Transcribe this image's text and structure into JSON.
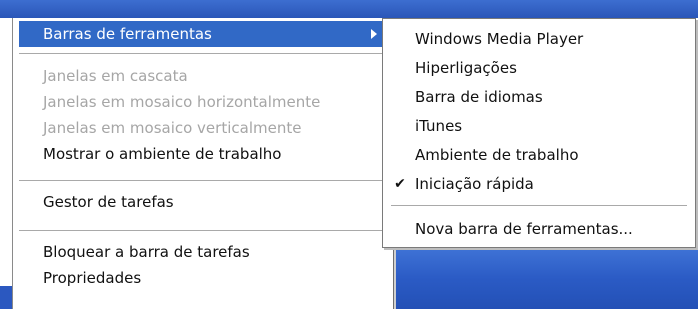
{
  "context_menu": {
    "items": [
      {
        "label": "Barras de ferramentas",
        "state": "selected",
        "has_submenu": true
      },
      {
        "label": "Janelas em cascata",
        "state": "disabled"
      },
      {
        "label": "Janelas em mosaico horizontalmente",
        "state": "disabled"
      },
      {
        "label": "Janelas em mosaico verticalmente",
        "state": "disabled"
      },
      {
        "label": "Mostrar o ambiente de trabalho",
        "state": "enabled"
      },
      {
        "label": "Gestor de tarefas",
        "state": "enabled"
      },
      {
        "label": "Bloquear a barra de tarefas",
        "state": "enabled"
      },
      {
        "label": "Propriedades",
        "state": "enabled"
      }
    ]
  },
  "toolbars_submenu": {
    "items": [
      {
        "label": "Windows Media Player",
        "checked": false
      },
      {
        "label": "Hiperligações",
        "checked": false
      },
      {
        "label": "Barra de idiomas",
        "checked": false
      },
      {
        "label": "iTunes",
        "checked": false
      },
      {
        "label": "Ambiente de trabalho",
        "checked": false
      },
      {
        "label": "Iniciação rápida",
        "checked": true
      },
      {
        "label": "Nova barra de ferramentas...",
        "checked": false
      }
    ],
    "check_glyph": "✔"
  },
  "colors": {
    "selection": "#3169c6",
    "disabled_text": "#a6a6a6",
    "taskbar": "#2b5bc5"
  }
}
